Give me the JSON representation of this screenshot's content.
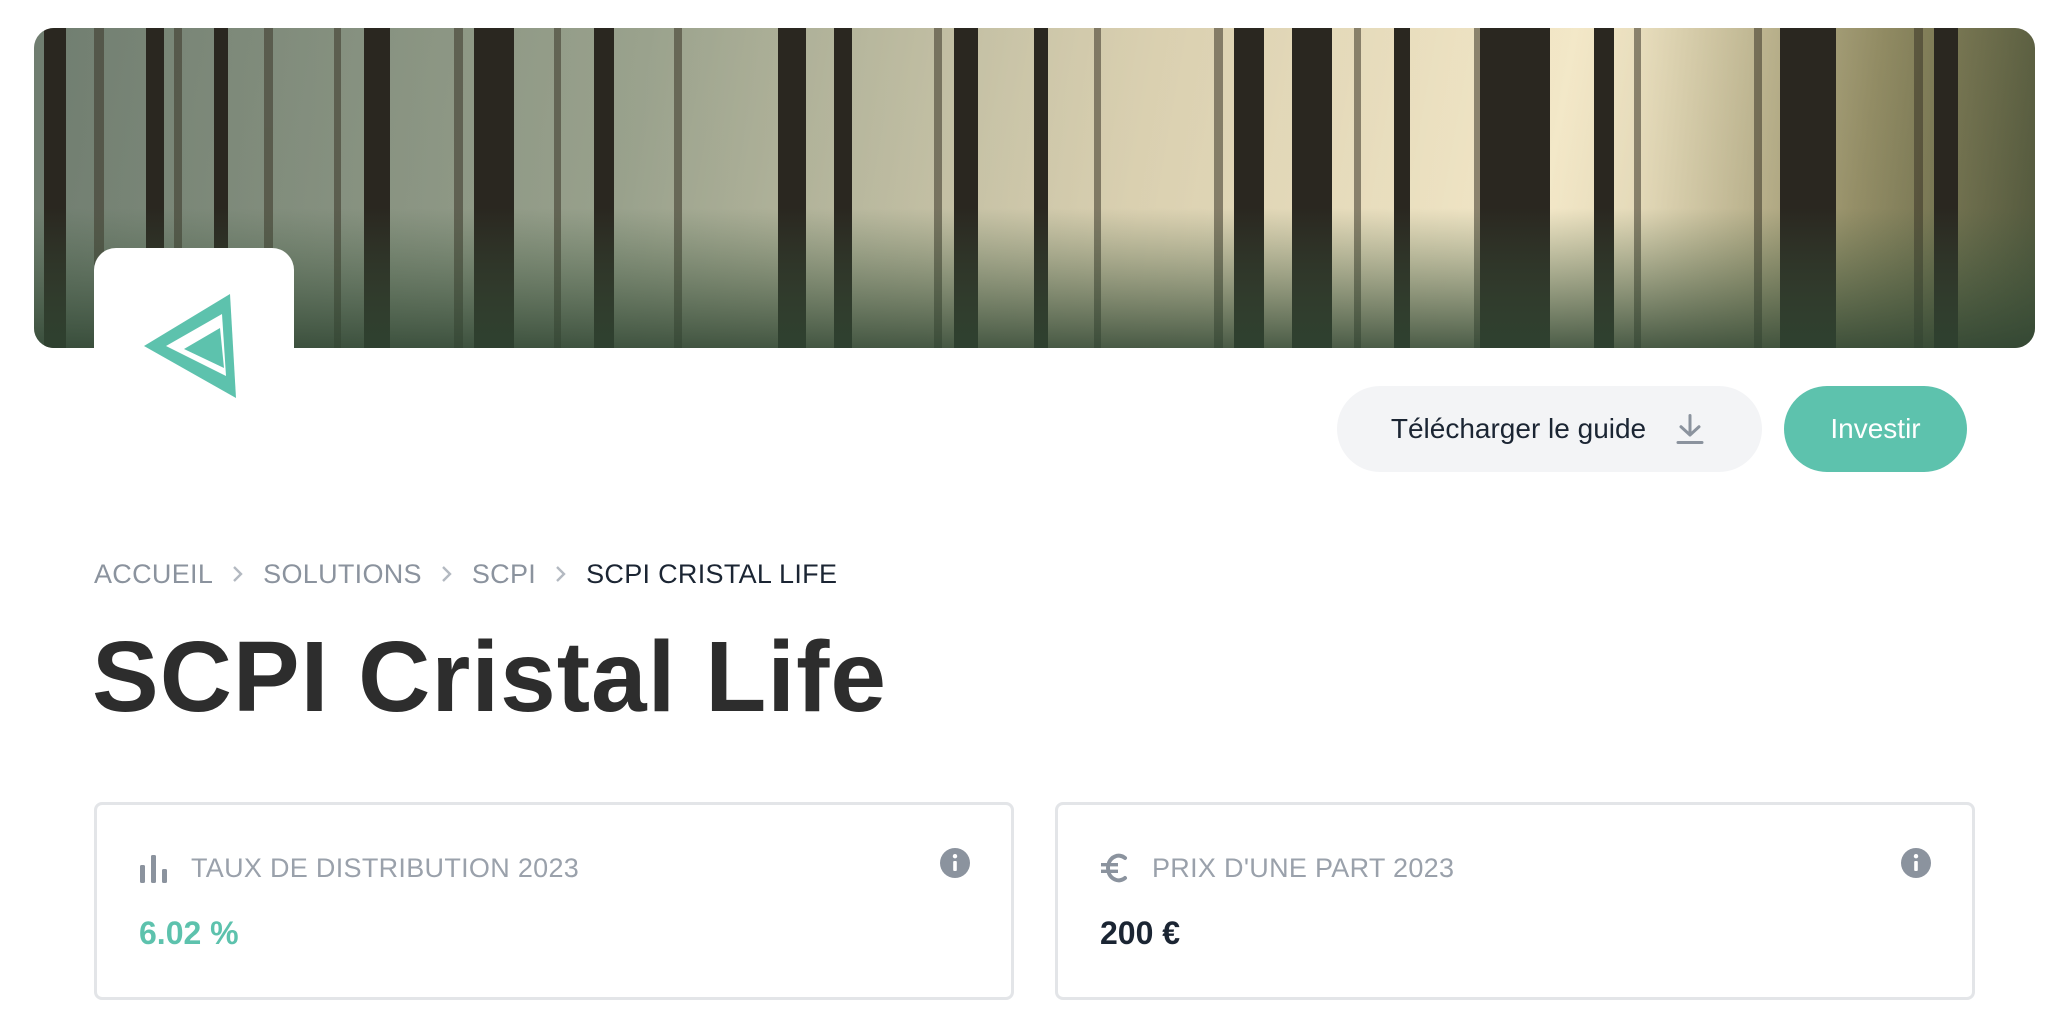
{
  "hero": {
    "image": "forest-banner"
  },
  "logo": {
    "icon": "arrow-logo-icon",
    "color": "#5dc2ad"
  },
  "actions": {
    "guide_label": "Télécharger le guide",
    "guide_icon": "download-icon",
    "invest_label": "Investir"
  },
  "breadcrumb": {
    "items": [
      "ACCUEIL",
      "SOLUTIONS",
      "SCPI",
      "SCPI CRISTAL LIFE"
    ]
  },
  "page": {
    "title": "SCPI Cristal Life"
  },
  "stats": [
    {
      "label": "TAUX DE DISTRIBUTION 2023",
      "value": "6.02 %",
      "icon": "bar-chart-icon"
    },
    {
      "label": "PRIX D'UNE PART 2023",
      "value": "200 €",
      "icon": "euro-icon"
    }
  ],
  "colors": {
    "accent": "#5dc2ad",
    "text_dark": "#1b2533",
    "muted": "#8b939e"
  }
}
